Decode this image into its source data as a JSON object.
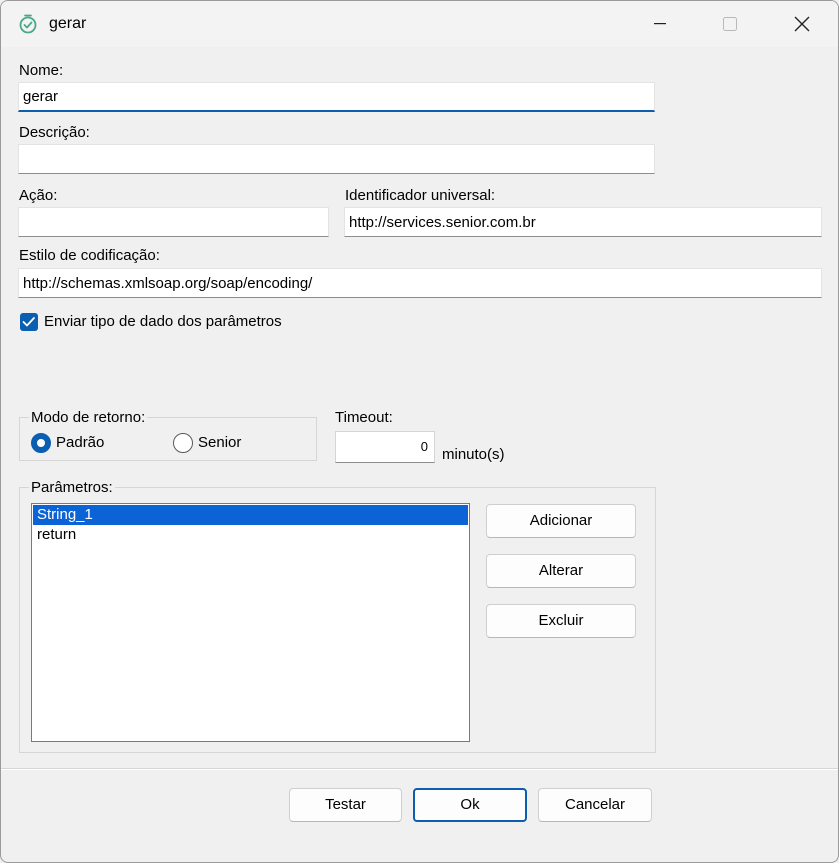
{
  "window": {
    "title": "gerar"
  },
  "form": {
    "nome_label": "Nome:",
    "nome_value": "gerar",
    "descricao_label": "Descrição:",
    "descricao_value": "",
    "acao_label": "Ação:",
    "acao_value": "",
    "identificador_label": "Identificador universal:",
    "identificador_value": "http://services.senior.com.br",
    "estilo_label": "Estilo de codificação:",
    "estilo_value": "http://schemas.xmlsoap.org/soap/encoding/",
    "enviar_tipo_label": "Enviar tipo de dado dos parâmetros",
    "enviar_tipo_checked": true
  },
  "modo_retorno": {
    "label": "Modo de retorno:",
    "options": [
      "Padrão",
      "Senior"
    ],
    "selected": "Padrão"
  },
  "timeout": {
    "label": "Timeout:",
    "value": "0",
    "unit": "minuto(s)"
  },
  "parametros": {
    "label": "Parâmetros:",
    "items": [
      "String_1",
      "return"
    ],
    "selected_index": 0,
    "buttons": {
      "add": "Adicionar",
      "edit": "Alterar",
      "delete": "Excluir"
    }
  },
  "footer": {
    "test": "Testar",
    "ok": "Ok",
    "cancel": "Cancelar"
  },
  "colors": {
    "accent": "#0b5fb0",
    "selection": "#0b63d6",
    "window_bg": "#f0f0f0"
  },
  "icons": {
    "app": "timer-check-icon",
    "minimize": "minimize-icon",
    "maximize": "maximize-icon",
    "close": "close-icon"
  }
}
